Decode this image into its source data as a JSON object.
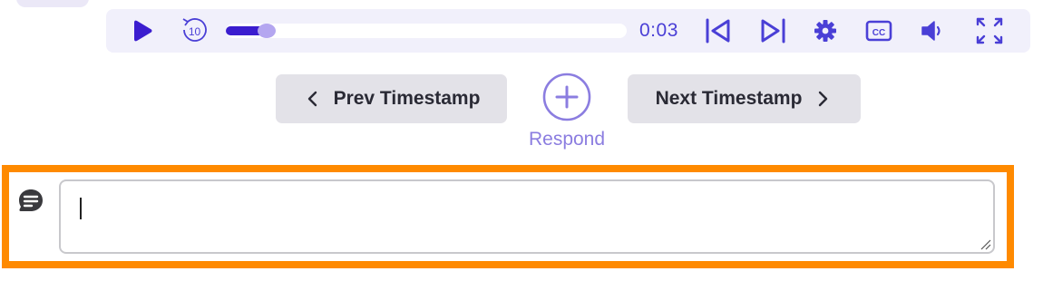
{
  "player": {
    "time": "0:03",
    "progress_fraction": 0.07,
    "rewind_seconds": "10",
    "cc_label": "CC",
    "colors": {
      "accent": "#3b1dcf",
      "accent_light": "#b4a6f0",
      "bar_bg": "#f1f0fb"
    }
  },
  "timestamp_nav": {
    "prev_label": "Prev Timestamp",
    "next_label": "Next Timestamp"
  },
  "respond": {
    "label": "Respond"
  },
  "comment": {
    "value": "",
    "placeholder": ""
  },
  "icons": [
    "play-icon",
    "rewind-10-icon",
    "previous-marker-icon",
    "next-marker-icon",
    "gear-icon",
    "closed-captions-icon",
    "volume-icon",
    "fullscreen-icon",
    "chevron-left-icon",
    "chevron-right-icon",
    "plus-circle-icon",
    "comment-icon"
  ],
  "highlight_color": "#ff8a00"
}
